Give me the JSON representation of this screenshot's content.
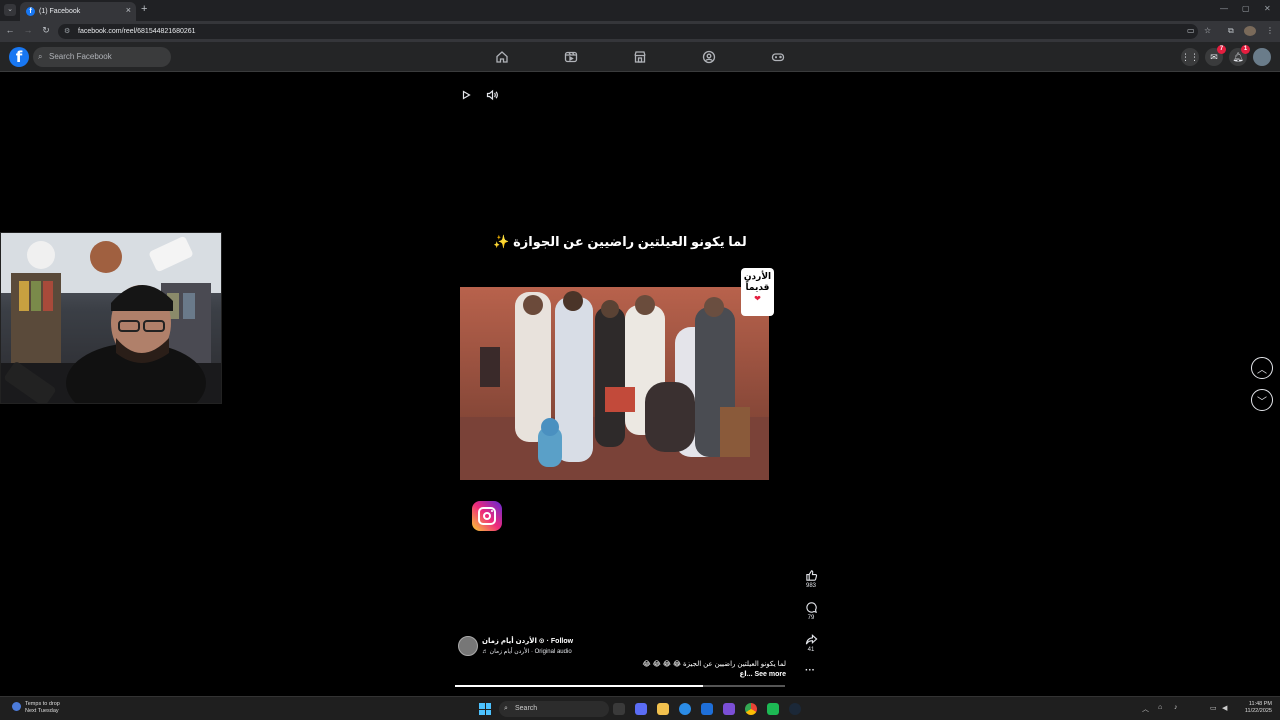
{
  "browser": {
    "tab_title": "(1) Facebook",
    "tab_close": "×",
    "new_tab": "+",
    "url": "facebook.com/reel/681544821680261"
  },
  "facebook": {
    "logo": "f",
    "search_placeholder": "Search Facebook",
    "nav_icons": [
      "home-icon",
      "video-icon",
      "marketplace-icon",
      "groups-icon",
      "gaming-icon"
    ],
    "messenger_badge": "7",
    "notifications_badge": "1"
  },
  "reel": {
    "overlay_title": "لما يكونو العيلتين راضيين عن الجوازة ✨",
    "corner_badge_line1": "الأردن",
    "corner_badge_line2": "قديماً",
    "likes": "983",
    "comments": "79",
    "shares": "41",
    "page_name": "الأردن أيام زمان ⊙ · Follow",
    "audio": "♬ الأردن أيام زمان · Original audio",
    "caption": "لما يكونو العيلتين راضيين عن الجيزة 😂 😂 😂 😂",
    "see_more": "اع... See more",
    "more": "···",
    "progress": 0.75
  },
  "taskbar": {
    "weather_line1": "Temps to drop",
    "weather_line2": "Next Tuesday",
    "search_label": "Search",
    "time": "11:48 PM",
    "date": "11/22/2025"
  }
}
